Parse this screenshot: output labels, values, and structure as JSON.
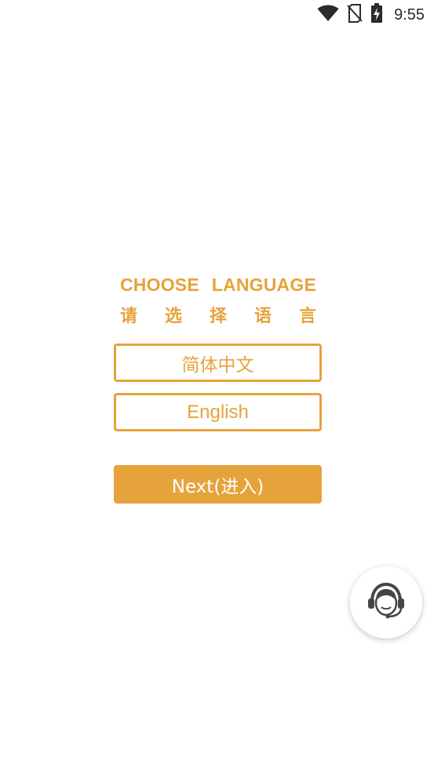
{
  "status_bar": {
    "time": "9:55",
    "icons": [
      "wifi-icon",
      "no-sim-icon",
      "battery-charging-icon"
    ]
  },
  "heading": {
    "en_words": [
      "CHOOSE",
      "LANGUAGE"
    ],
    "zh_chars": [
      "请",
      "选",
      "择",
      "语",
      "言"
    ]
  },
  "languages": {
    "chinese_label": "简体中文",
    "english_label": "English"
  },
  "next_button": {
    "label": "Next(进入)"
  },
  "support": {
    "icon": "customer-service-headset-icon"
  },
  "colors": {
    "accent": "#e6a33b",
    "background": "#ffffff",
    "status_icon": "#2b2b2b"
  }
}
